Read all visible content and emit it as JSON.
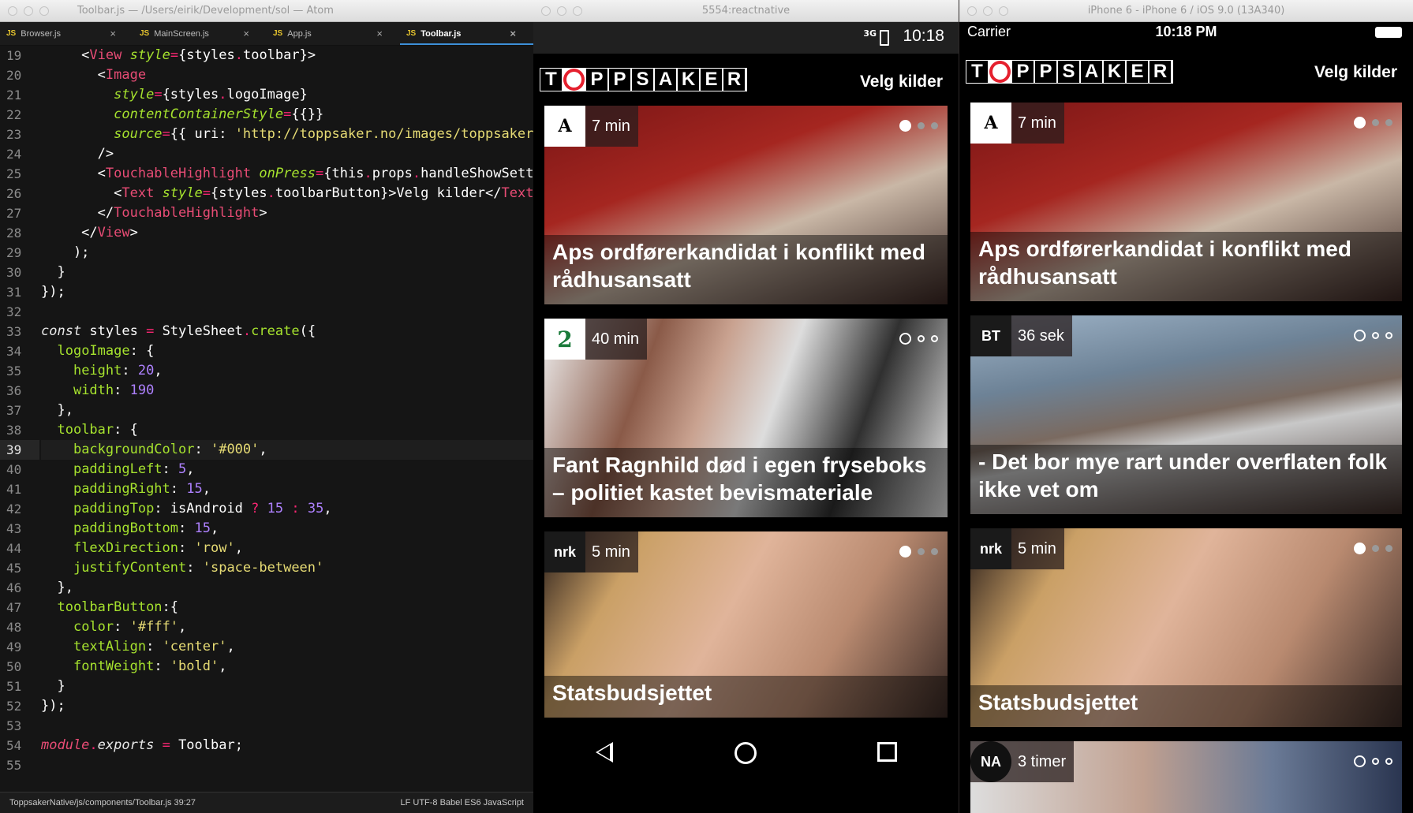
{
  "atom": {
    "title": "Toolbar.js — /Users/eirik/Development/sol — Atom",
    "tabs": [
      "Browser.js",
      "MainScreen.js",
      "App.js",
      "Toolbar.js"
    ],
    "js_badge": "JS",
    "close_glyph": "×",
    "status_left": "ToppsakerNative/js/components/Toolbar.js   39:27",
    "status_right": "LF   UTF-8   Babel ES6 JavaScript",
    "current_line": 39,
    "line_numbers": [
      19,
      20,
      21,
      22,
      23,
      24,
      25,
      26,
      27,
      28,
      29,
      30,
      31,
      32,
      33,
      34,
      35,
      36,
      37,
      38,
      39,
      40,
      41,
      42,
      43,
      44,
      45,
      46,
      47,
      48,
      49,
      50,
      51,
      52,
      53,
      54,
      55
    ]
  },
  "android": {
    "window_title": "5554:reactnative",
    "network": "3G",
    "time": "10:18",
    "logo_letters": [
      "T",
      "O",
      "P",
      "P",
      "S",
      "A",
      "K",
      "E",
      "R"
    ],
    "velg": "Velg kilder",
    "cards": [
      {
        "logo": "A",
        "time": "7 min",
        "headline": "Aps ordførerkandidat i konflikt med rådhusansatt",
        "img": "ap"
      },
      {
        "logo": "2",
        "time": "40 min",
        "headline": "Fant Ragnhild død i egen fryseboks – politiet kastet bevismateriale",
        "img": "tv2"
      },
      {
        "logo": "nrk",
        "time": "5 min",
        "headline": "Statsbudsjettet",
        "img": "nrk"
      }
    ]
  },
  "ios": {
    "window_title": "iPhone 6 - iPhone 6 / iOS 9.0 (13A340)",
    "carrier": "Carrier",
    "time": "10:18 PM",
    "velg": "Velg kilder",
    "cards": [
      {
        "logo": "A",
        "time": "7 min",
        "headline": "Aps ordførerkandidat i konflikt med rådhusansatt"
      },
      {
        "logo": "BT",
        "time": "36 sek",
        "headline": "- Det bor mye rart under overflaten folk ikke vet om"
      },
      {
        "logo": "nrk",
        "time": "5 min",
        "headline": "Statsbudsjettet"
      },
      {
        "logo": "NA",
        "time": "3 timer",
        "headline": ""
      }
    ]
  },
  "colors": {
    "accent": "#3d8fd8",
    "logo_red": "#e5202e"
  }
}
